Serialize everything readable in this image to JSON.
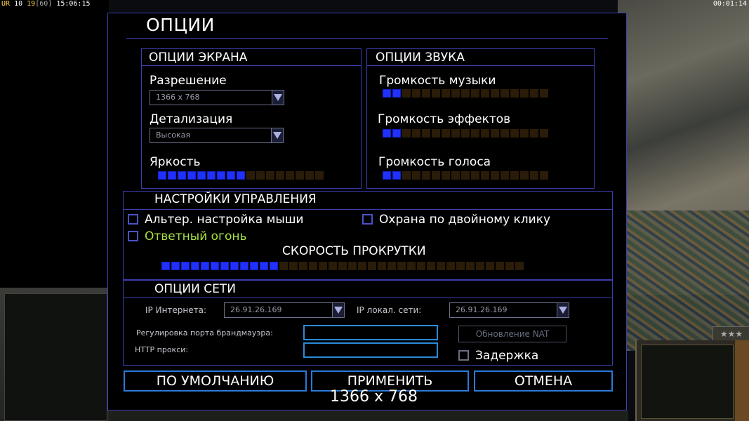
{
  "hud": {
    "left_prefix": "UR",
    "left_a": "10",
    "left_b": "19",
    "left_c": "[60]",
    "left_time": "15:06:15",
    "right_time": "00:01:14"
  },
  "title": "ОПЦИИ",
  "screen": {
    "header": "ОПЦИИ ЭКРАНА",
    "resolution_label": "Разрешение",
    "resolution_value": "1366 x 768",
    "detail_label": "Детализация",
    "detail_value": "Высокая",
    "brightness_label": "Яркость",
    "brightness_level": 9,
    "brightness_total": 17
  },
  "sound": {
    "header": "ОПЦИИ ЗВУКА",
    "music_label": "Громкость музыки",
    "music_level": 2,
    "effects_label": "Громкость эффектов",
    "effects_level": 2,
    "voice_label": "Громкость голоса",
    "voice_level": 2,
    "total": 17
  },
  "controls": {
    "header": "НАСТРОЙКИ УПРАВЛЕНИЯ",
    "alt_mouse_label": "Альтер. настройка мыши",
    "alt_mouse_checked": false,
    "double_click_label": "Охрана по двойному клику",
    "double_click_checked": false,
    "return_fire_label": "Ответный огонь",
    "return_fire_checked": false,
    "scroll_label": "СКОРОСТЬ ПРОКРУТКИ",
    "scroll_level": 12,
    "scroll_total": 37
  },
  "network": {
    "header": "ОПЦИИ СЕТИ",
    "internet_ip_label": "IP Интернета:",
    "internet_ip_value": "26.91.26.169",
    "lan_ip_label": "IP локал. сети:",
    "lan_ip_value": "26.91.26.169",
    "firewall_label": "Регулировка порта брандмауэра:",
    "http_proxy_label": "HTTP прокси:",
    "nat_button": "Обновление NAT",
    "delay_label": "Задержка",
    "delay_checked": false
  },
  "buttons": {
    "default": "ПО УМОЛЧАНИЮ",
    "apply": "ПРИМЕНИТЬ",
    "cancel": "ОТМЕНА"
  },
  "overlay_resolution": "1366 x 768",
  "colors": {
    "border": "#3b3fb0",
    "slider_on": "#2030ff",
    "slider_off": "#2a1c08",
    "button_border": "#2a7ad8",
    "highlight_text": "#a8e040"
  }
}
